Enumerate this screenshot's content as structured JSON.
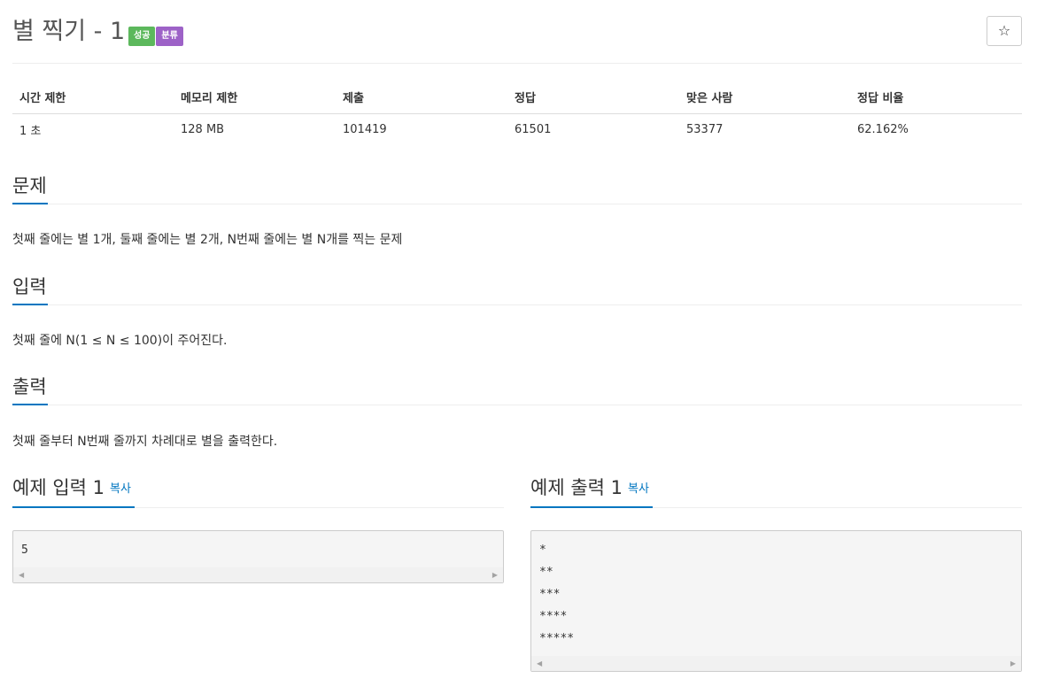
{
  "header": {
    "title": "별 찍기 - 1",
    "badges": {
      "success": "성공",
      "category": "분류"
    },
    "star_icon": "☆"
  },
  "info": {
    "headers": [
      "시간 제한",
      "메모리 제한",
      "제출",
      "정답",
      "맞은 사람",
      "정답 비율"
    ],
    "values": [
      "1 초",
      "128 MB",
      "101419",
      "61501",
      "53377",
      "62.162%"
    ]
  },
  "sections": {
    "problem": {
      "title": "문제",
      "text": "첫째 줄에는 별 1개, 둘째 줄에는 별 2개, N번째 줄에는 별 N개를 찍는 문제"
    },
    "input": {
      "title": "입력",
      "text": "첫째 줄에 N(1 ≤ N ≤ 100)이 주어진다."
    },
    "output": {
      "title": "출력",
      "text": "첫째 줄부터 N번째 줄까지 차례대로 별을 출력한다."
    }
  },
  "samples": {
    "input": {
      "title": "예제 입력 1",
      "copy_label": "복사",
      "content": "5"
    },
    "output": {
      "title": "예제 출력 1",
      "copy_label": "복사",
      "content": "*\n**\n***\n****\n*****"
    }
  },
  "colors": {
    "accent": "#0076c0",
    "success_badge": "#5cb85c",
    "category_badge": "#9d62c7"
  }
}
